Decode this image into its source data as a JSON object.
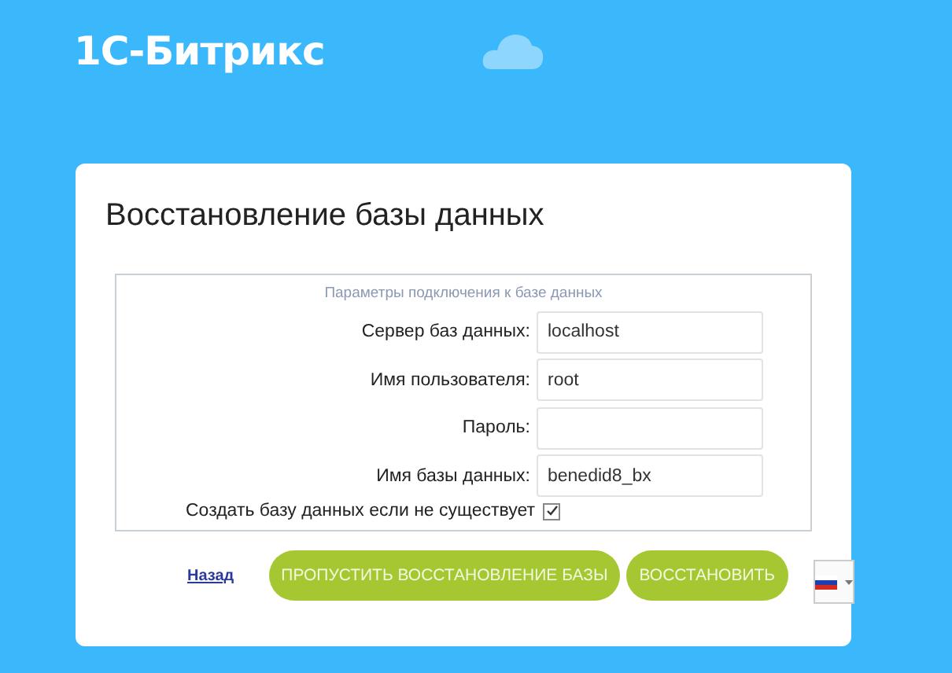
{
  "logo": "1С-Битрикс",
  "card": {
    "title": "Восстановление базы данных",
    "fieldset": {
      "legend": "Параметры подключения к базе данных",
      "fields": [
        {
          "label": "Сервер баз данных:",
          "value": "localhost"
        },
        {
          "label": "Имя пользователя:",
          "value": "root"
        },
        {
          "label": "Пароль:"
        },
        {
          "label": "Имя базы данных:",
          "value": "benedid8_bx"
        }
      ],
      "create_db": {
        "label": "Создать базу данных если не существует",
        "checked": true
      }
    },
    "back_link": "Назад",
    "buttons": [
      "ПРОПУСТИТЬ ВОССТАНОВЛЕНИЕ БАЗЫ",
      "ВОССТАНОВИТЬ"
    ]
  }
}
